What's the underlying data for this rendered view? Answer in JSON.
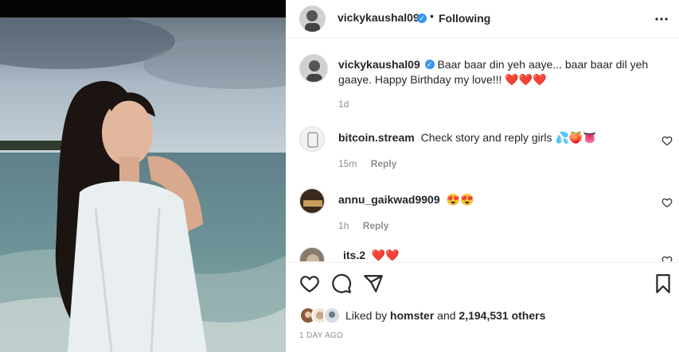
{
  "post": {
    "author": "vickykaushal09",
    "follow_dot": "•",
    "follow_label": "Following",
    "caption": "Baar baar din yeh aaye... baar baar dil yeh gaaye. Happy Birthday my love!!!",
    "caption_emoji": "❤️❤️❤️",
    "caption_time": "1d"
  },
  "comments": [
    {
      "user": "bitcoin.stream",
      "text": "Check story and reply girls",
      "emoji": "💦🍑👅",
      "time": "15m",
      "reply": "Reply"
    },
    {
      "user": "annu_gaikwad9909",
      "text": "",
      "emoji": "😍😍",
      "time": "1h",
      "reply": "Reply"
    },
    {
      "user": "its.2",
      "text": "",
      "emoji": "❤️❤️",
      "time": "",
      "reply": ""
    }
  ],
  "likes": {
    "prefix": "Liked by",
    "user": "homster",
    "and": "and",
    "count": "2,194,531 others"
  },
  "time_ago": "1 DAY AGO",
  "icons": {
    "verified": "verified-badge-icon",
    "more": "more-options-icon",
    "like": "heart-icon",
    "comment": "comment-icon",
    "share": "share-icon",
    "save": "bookmark-icon"
  },
  "colors": {
    "verified": "#3897f0",
    "heart": "#ed2d3d",
    "muted": "#8e8e8e"
  }
}
